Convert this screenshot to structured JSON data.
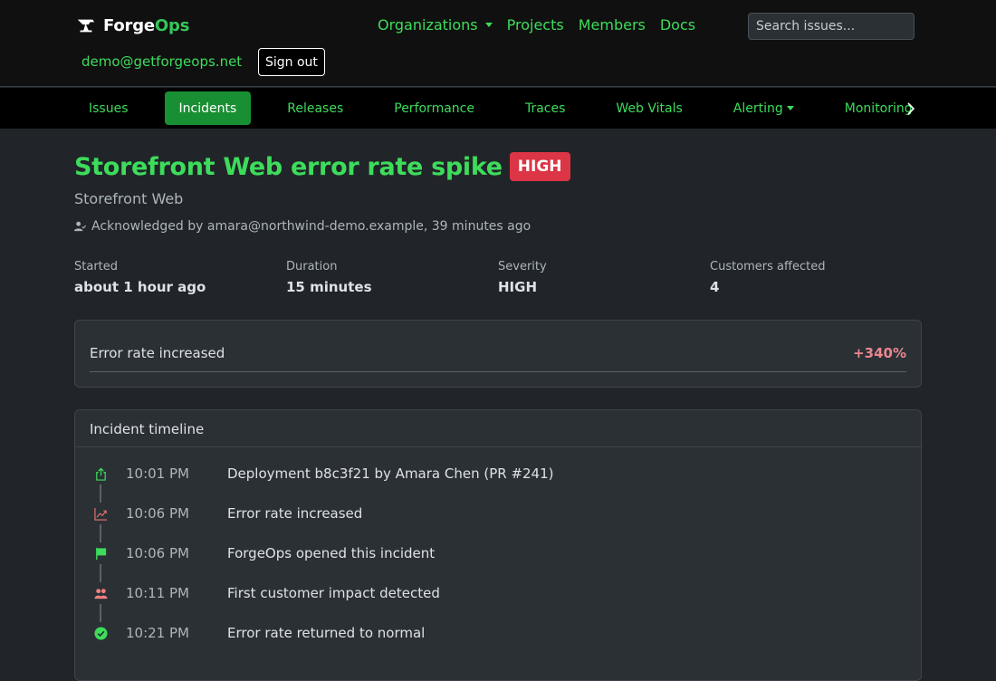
{
  "brand": {
    "part1": "Forge",
    "part2": "Ops"
  },
  "topnav": {
    "items": [
      {
        "label": "Organizations",
        "dropdown": true
      },
      {
        "label": "Projects",
        "dropdown": false
      },
      {
        "label": "Members",
        "dropdown": false
      },
      {
        "label": "Docs",
        "dropdown": false
      }
    ]
  },
  "search": {
    "placeholder": "Search issues..."
  },
  "user": {
    "email": "demo@getforgeops.net",
    "signout_label": "Sign out"
  },
  "subnav": {
    "tabs": [
      "Issues",
      "Incidents",
      "Releases",
      "Performance",
      "Traces",
      "Web Vitals",
      "Alerting",
      "Monitoring"
    ],
    "active": "Incidents"
  },
  "incident": {
    "title": "Storefront Web error rate spike",
    "severity_badge": "HIGH",
    "project": "Storefront Web",
    "acknowledged": "Acknowledged by amara@northwind-demo.example, 39 minutes ago",
    "stats": [
      {
        "label": "Started",
        "value": "about 1 hour ago"
      },
      {
        "label": "Duration",
        "value": "15 minutes"
      },
      {
        "label": "Severity",
        "value": "HIGH"
      },
      {
        "label": "Customers affected",
        "value": "4"
      }
    ],
    "error_rate": {
      "label": "Error rate increased",
      "value": "+340%"
    }
  },
  "timeline": {
    "header": "Incident timeline",
    "events": [
      {
        "time": "10:01 PM",
        "text": "Deployment b8c3f21 by Amara Chen (PR #241)",
        "icon": "deploy-icon"
      },
      {
        "time": "10:06 PM",
        "text": "Error rate increased",
        "icon": "trend-up-icon"
      },
      {
        "time": "10:06 PM",
        "text": "ForgeOps opened this incident",
        "icon": "flag-icon"
      },
      {
        "time": "10:11 PM",
        "text": "First customer impact detected",
        "icon": "people-icon"
      },
      {
        "time": "10:21 PM",
        "text": "Error rate returned to normal",
        "icon": "check-circle-icon"
      }
    ]
  },
  "colors": {
    "accent": "#3ddc5b",
    "active_tab": "#198f33",
    "danger": "#dc3545",
    "danger_text": "#ea868f",
    "trend_icon": "#e8776f",
    "people_icon": "#f08080"
  }
}
